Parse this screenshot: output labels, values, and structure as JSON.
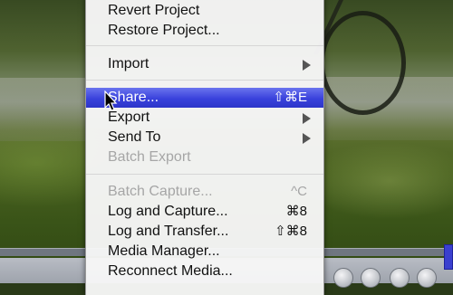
{
  "menu": {
    "items": [
      {
        "label": "Revert Project",
        "shortcut": "",
        "submenu": false,
        "enabled": true
      },
      {
        "label": "Restore Project...",
        "shortcut": "",
        "submenu": false,
        "enabled": true
      },
      {
        "label": "Import",
        "shortcut": "",
        "submenu": true,
        "enabled": true
      },
      {
        "label": "Share...",
        "shortcut": "⇧⌘E",
        "submenu": false,
        "enabled": true,
        "selected": true
      },
      {
        "label": "Export",
        "shortcut": "",
        "submenu": true,
        "enabled": true
      },
      {
        "label": "Send To",
        "shortcut": "",
        "submenu": true,
        "enabled": true
      },
      {
        "label": "Batch Export",
        "shortcut": "",
        "submenu": false,
        "enabled": false
      },
      {
        "label": "Batch Capture...",
        "shortcut": "^C",
        "submenu": false,
        "enabled": false
      },
      {
        "label": "Log and Capture...",
        "shortcut": "⌘8",
        "submenu": false,
        "enabled": true
      },
      {
        "label": "Log and Transfer...",
        "shortcut": "⇧⌘8",
        "submenu": false,
        "enabled": true
      },
      {
        "label": "Media Manager...",
        "shortcut": "",
        "submenu": false,
        "enabled": true
      },
      {
        "label": "Reconnect Media...",
        "shortcut": "",
        "submenu": false,
        "enabled": true
      }
    ]
  },
  "colors": {
    "selection": "#3942dc",
    "disabled_text": "#a6a6a6",
    "menu_background": "#f6f6f6"
  }
}
